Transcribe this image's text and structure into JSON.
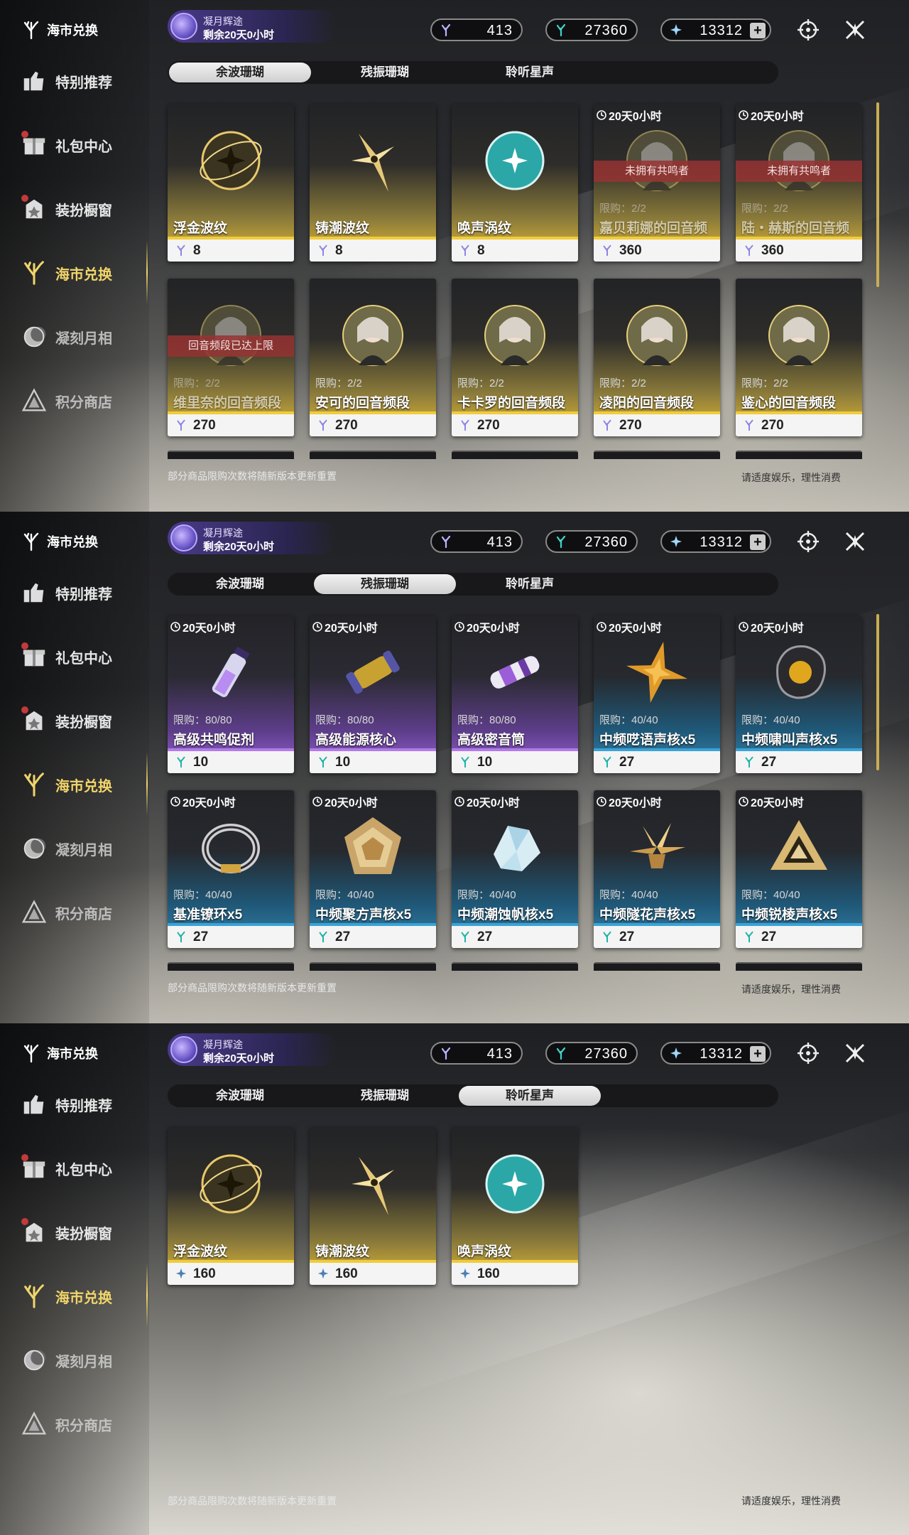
{
  "sidebar": {
    "title": "海市兑换",
    "items": [
      {
        "label": "特别推荐",
        "icon": "thumbs-up-icon",
        "badge": false
      },
      {
        "label": "礼包中心",
        "icon": "gift-icon",
        "badge": true
      },
      {
        "label": "装扮橱窗",
        "icon": "wardrobe-icon",
        "badge": true
      },
      {
        "label": "海市兑换",
        "icon": "coral-icon",
        "badge": false,
        "active": true
      },
      {
        "label": "凝刻月相",
        "icon": "moon-icon",
        "badge": false
      },
      {
        "label": "积分商店",
        "icon": "triangle-emblem-icon",
        "badge": false
      }
    ]
  },
  "event": {
    "line1": "凝月辉途",
    "line2": "剩余20天0小时"
  },
  "currencies": [
    {
      "icon": "afterglow-coral-icon",
      "value": "413"
    },
    {
      "icon": "oscillated-coral-icon",
      "value": "27360"
    },
    {
      "icon": "star-sound-icon",
      "value": "13312",
      "plus": "+"
    }
  ],
  "tabs": [
    "余波珊瑚",
    "残振珊瑚",
    "聆听星声"
  ],
  "footer": {
    "left": "部分商品限购次数将随新版本更新重置",
    "right": "请适度娱乐，理性消费"
  },
  "panel1": {
    "selected_tab": 0,
    "cards": [
      {
        "name": "浮金波纹",
        "price": "8",
        "theme": "gold",
        "art": "gold-orb"
      },
      {
        "name": "铸潮波纹",
        "price": "8",
        "theme": "gold",
        "art": "gold-blade"
      },
      {
        "name": "唤声涡纹",
        "price": "8",
        "theme": "gold",
        "art": "teal-orb"
      },
      {
        "name": "嘉贝莉娜的回音频段",
        "price": "360",
        "theme": "gold",
        "timer": "20天0小时",
        "flag": "未拥有共鸣者",
        "limit": "限购：2/2",
        "art": "portrait",
        "dim": true
      },
      {
        "name": "陆・赫斯的回音频段",
        "price": "360",
        "theme": "gold",
        "timer": "20天0小时",
        "flag": "未拥有共鸣者",
        "limit": "限购：2/2",
        "art": "portrait",
        "dim": true
      },
      {
        "name": "维里奈的回音频段",
        "price": "270",
        "theme": "gold",
        "flag": "回音频段已达上限",
        "limit": "限购：2/2",
        "art": "portrait",
        "dim": true
      },
      {
        "name": "安可的回音频段",
        "price": "270",
        "theme": "gold",
        "limit": "限购：2/2",
        "art": "portrait"
      },
      {
        "name": "卡卡罗的回音频段",
        "price": "270",
        "theme": "gold",
        "limit": "限购：2/2",
        "art": "portrait"
      },
      {
        "name": "凌阳的回音频段",
        "price": "270",
        "theme": "gold",
        "limit": "限购：2/2",
        "art": "portrait"
      },
      {
        "name": "鉴心的回音频段",
        "price": "270",
        "theme": "gold",
        "limit": "限购：2/2",
        "art": "portrait"
      }
    ]
  },
  "panel2": {
    "selected_tab": 1,
    "cards": [
      {
        "name": "高级共鸣促剂",
        "price": "10",
        "theme": "purple",
        "timer": "20天0小时",
        "limit": "限购：80/80",
        "art": "vial"
      },
      {
        "name": "高级能源核心",
        "price": "10",
        "theme": "purple",
        "timer": "20天0小时",
        "limit": "限购：80/80",
        "art": "core"
      },
      {
        "name": "高级密音筒",
        "price": "10",
        "theme": "purple",
        "timer": "20天0小时",
        "limit": "限购：80/80",
        "art": "cylinder"
      },
      {
        "name": "中频呓语声核x5",
        "price": "27",
        "theme": "blue",
        "timer": "20天0小时",
        "limit": "限购：40/40",
        "art": "star"
      },
      {
        "name": "中频啸叫声核x5",
        "price": "27",
        "theme": "blue",
        "timer": "20天0小时",
        "limit": "限购：40/40",
        "art": "dark-core"
      },
      {
        "name": "基准镣环x5",
        "price": "27",
        "theme": "blue",
        "timer": "20天0小时",
        "limit": "限购：40/40",
        "art": "ring"
      },
      {
        "name": "中频聚方声核x5",
        "price": "27",
        "theme": "blue",
        "timer": "20天0小时",
        "limit": "限购：40/40",
        "art": "pentagon"
      },
      {
        "name": "中频潮蚀帆核x5",
        "price": "27",
        "theme": "blue",
        "timer": "20天0小时",
        "limit": "限购：40/40",
        "art": "crystal"
      },
      {
        "name": "中频隧花声核x5",
        "price": "27",
        "theme": "blue",
        "timer": "20天0小时",
        "limit": "限购：40/40",
        "art": "flower"
      },
      {
        "name": "中频锐棱声核x5",
        "price": "27",
        "theme": "blue",
        "timer": "20天0小时",
        "limit": "限购：40/40",
        "art": "triangle"
      }
    ]
  },
  "panel3": {
    "selected_tab": 2,
    "cards": [
      {
        "name": "浮金波纹",
        "price": "160",
        "theme": "gold",
        "art": "gold-orb"
      },
      {
        "name": "铸潮波纹",
        "price": "160",
        "theme": "gold",
        "art": "gold-blade"
      },
      {
        "name": "唤声涡纹",
        "price": "160",
        "theme": "gold",
        "art": "teal-orb"
      }
    ]
  }
}
